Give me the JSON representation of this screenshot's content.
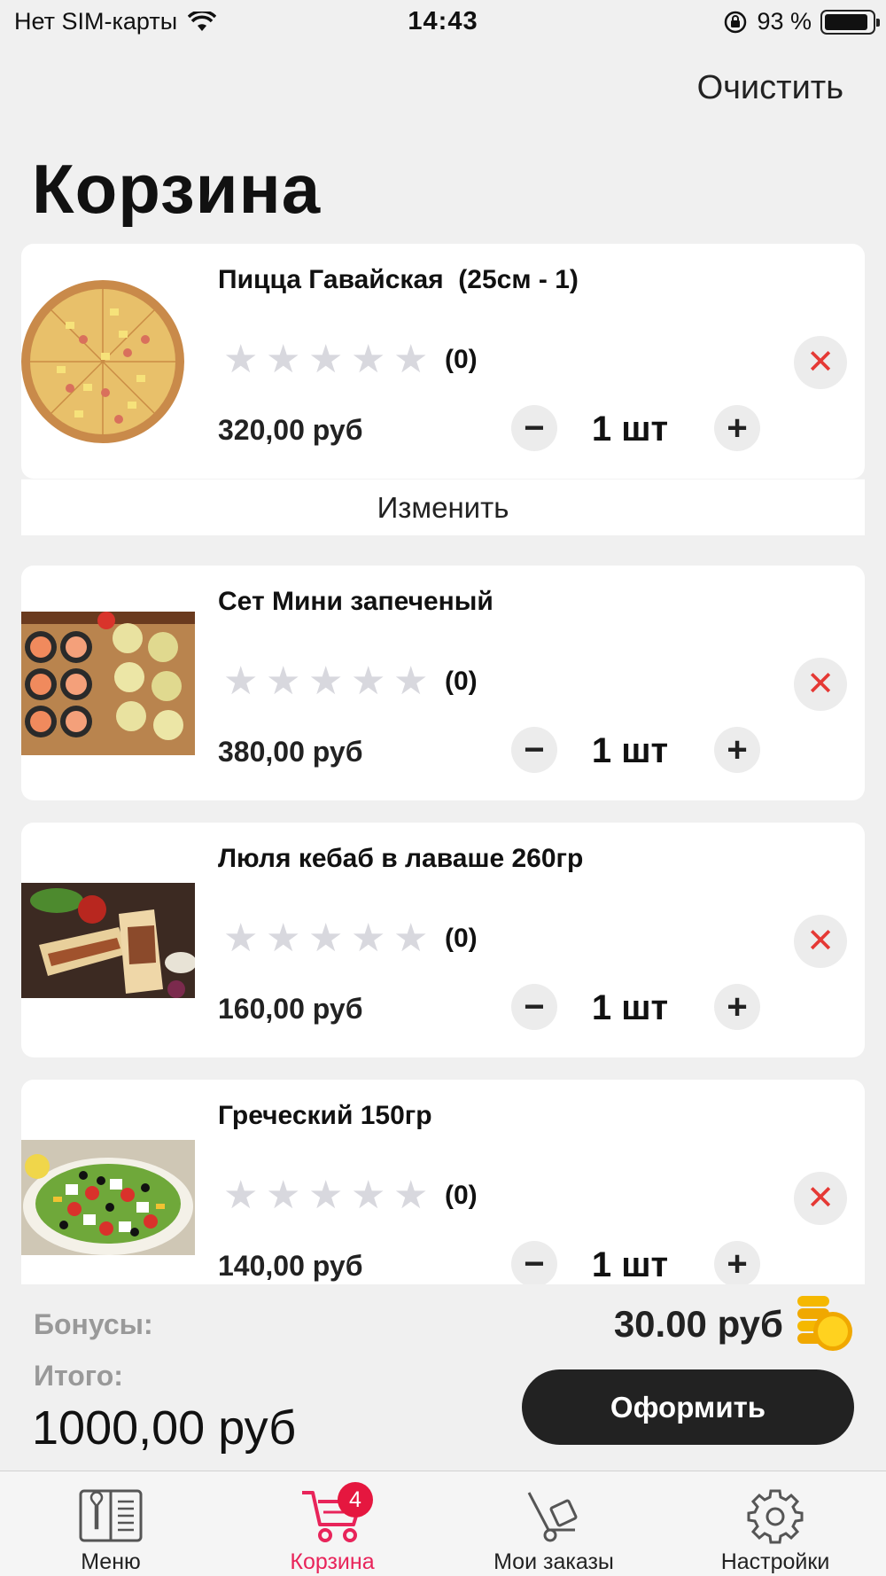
{
  "status_bar": {
    "carrier": "Нет SIM-карты",
    "time": "14:43",
    "battery": "93 %"
  },
  "header": {
    "clear_label": "Очистить",
    "title": "Корзина"
  },
  "cart": {
    "items": [
      {
        "name": "Пицца Гавайская  (25см - 1)",
        "rating_count": "(0)",
        "price": "320,00 руб",
        "quantity": "1 шт",
        "edit_label": "Изменить"
      },
      {
        "name": "Сет Мини запеченый",
        "rating_count": "(0)",
        "price": "380,00 руб",
        "quantity": "1 шт"
      },
      {
        "name": "Люля кебаб в лаваше 260гр",
        "rating_count": "(0)",
        "price": "160,00 руб",
        "quantity": "1 шт"
      },
      {
        "name": "Греческий 150гр",
        "rating_count": "(0)",
        "price": "140,00 руб",
        "quantity": "1 шт"
      }
    ],
    "rating_stars": 0,
    "rating_max": 5
  },
  "summary": {
    "bonus_label": "Бонусы:",
    "bonus_value": "30.00 руб",
    "total_label": "Итого:",
    "total_value": "1000,00 руб",
    "checkout_label": "Оформить"
  },
  "tabs": [
    {
      "label": "Меню",
      "icon": "menu-book-icon",
      "active": false
    },
    {
      "label": "Корзина",
      "icon": "cart-icon",
      "active": true,
      "badge": "4"
    },
    {
      "label": "Мои заказы",
      "icon": "hand-truck-icon",
      "active": false
    },
    {
      "label": "Настройки",
      "icon": "gear-icon",
      "active": false
    }
  ],
  "colors": {
    "accent": "#e8245a",
    "badge": "#e5173f",
    "remove": "#e53935",
    "checkout": "#222222",
    "star_empty": "#d8d8de"
  }
}
